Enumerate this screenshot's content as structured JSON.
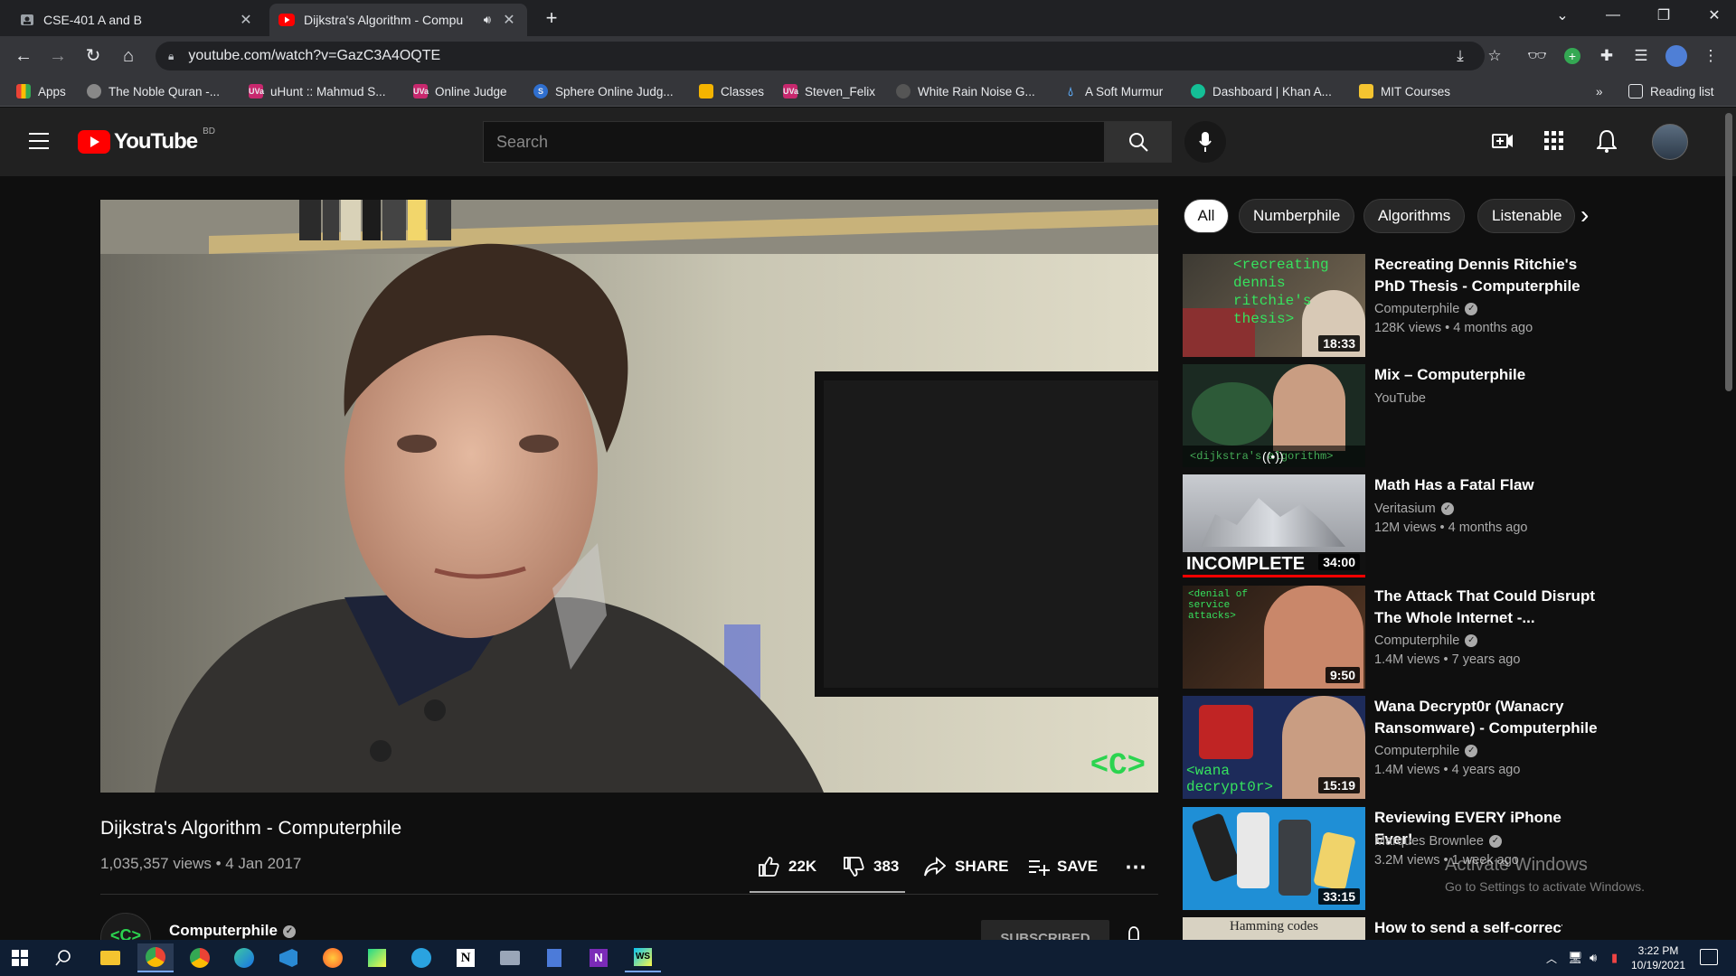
{
  "browser": {
    "tabs": [
      {
        "title": "CSE-401 A and B",
        "active": false
      },
      {
        "title": "Dijkstra's Algorithm - Compu",
        "active": true
      }
    ],
    "url": "youtube.com/watch?v=GazC3A4OQTE",
    "bookmarks": [
      "Apps",
      "The Noble Quran -...",
      "uHunt :: Mahmud S...",
      "Online Judge",
      "Sphere Online Judg...",
      "Classes",
      "Steven_Felix",
      "White Rain Noise G...",
      "A Soft Murmur",
      "Dashboard | Khan A...",
      "MIT Courses"
    ],
    "more_bookmarks": "»",
    "reading_list": "Reading list"
  },
  "youtube": {
    "logo_text": "YouTube",
    "region": "BD",
    "search_placeholder": "Search",
    "video": {
      "title": "Dijkstra's Algorithm - Computerphile",
      "views_date": "1,035,357 views • 4 Jan 2017",
      "likes": "22K",
      "dislikes": "383",
      "share": "SHARE",
      "save": "SAVE",
      "watermark": "<C>",
      "channel": "Computerphile",
      "subscribe": "SUBSCRIBED"
    },
    "chips": [
      "All",
      "Numberphile",
      "Algorithms",
      "Listenable"
    ],
    "recommendations": [
      {
        "title": "Recreating Dennis Ritchie's PhD Thesis - Computerphile",
        "channel": "Computerphile",
        "verified": true,
        "meta": "128K views • 4 months ago",
        "duration": "18:33",
        "thumb_text": "<recreating dennis ritchie's thesis>"
      },
      {
        "title": "Mix – Computerphile",
        "channel": "YouTube",
        "verified": false,
        "meta": "",
        "duration": "",
        "thumb_text": "<dijkstra's algorithm>"
      },
      {
        "title": "Math Has a Fatal Flaw",
        "channel": "Veritasium",
        "verified": true,
        "meta": "12M views • 4 months ago",
        "duration": "34:00",
        "thumb_text": "INCOMPLETE"
      },
      {
        "title": "The Attack That Could Disrupt The Whole Internet -...",
        "channel": "Computerphile",
        "verified": true,
        "meta": "1.4M views • 7 years ago",
        "duration": "9:50",
        "thumb_text": "<denial of service attacks>"
      },
      {
        "title": "Wana Decrypt0r (Wanacry Ransomware) - Computerphile",
        "channel": "Computerphile",
        "verified": true,
        "meta": "1.4M views • 4 years ago",
        "duration": "15:19",
        "thumb_text": "<wana decrypt0r>"
      },
      {
        "title": "Reviewing EVERY iPhone Ever!",
        "channel": "Marques Brownlee",
        "verified": true,
        "meta": "3.2M views • 1 week ago",
        "duration": "33:15",
        "thumb_text": ""
      },
      {
        "title": "How to send a self-correcting",
        "channel": "",
        "verified": false,
        "meta": "",
        "duration": "",
        "thumb_text": "Hamming codes"
      }
    ]
  },
  "watermark_os": {
    "line1": "Activate Windows",
    "line2": "Go to Settings to activate Windows."
  },
  "taskbar": {
    "time": "3:22 PM",
    "date": "10/19/2021"
  },
  "colors": {
    "yt_red": "#ff0000",
    "bg": "#0f0f0f",
    "header": "#212121"
  }
}
